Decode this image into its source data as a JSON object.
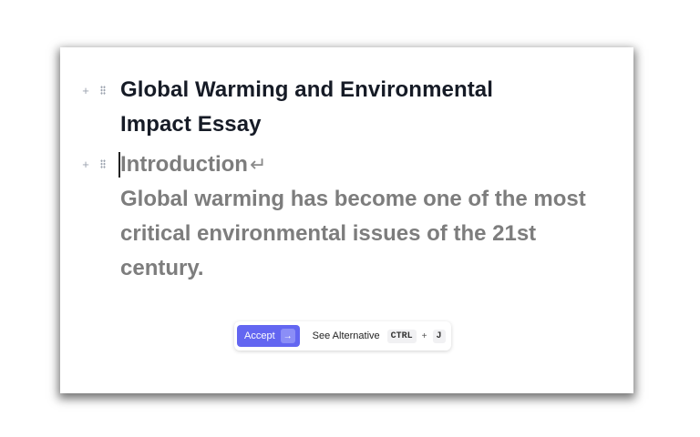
{
  "document": {
    "title": "Global Warming and Environmental Impact Essay",
    "suggestion_heading": "Introduction",
    "suggestion_body": "Global warming has become one of the most critical environmental issues of the 21st century."
  },
  "toolbar": {
    "accept_label": "Accept",
    "accept_icon": "→",
    "alternative_label": "See Alternative",
    "shortcut_key1": "CTRL",
    "shortcut_plus": "+",
    "shortcut_key2": "J"
  },
  "icons": {
    "add": "+",
    "return": "↵"
  },
  "colors": {
    "accent": "#6366f1",
    "suggestion_text": "#7d7d7d",
    "title_text": "#161b26"
  }
}
